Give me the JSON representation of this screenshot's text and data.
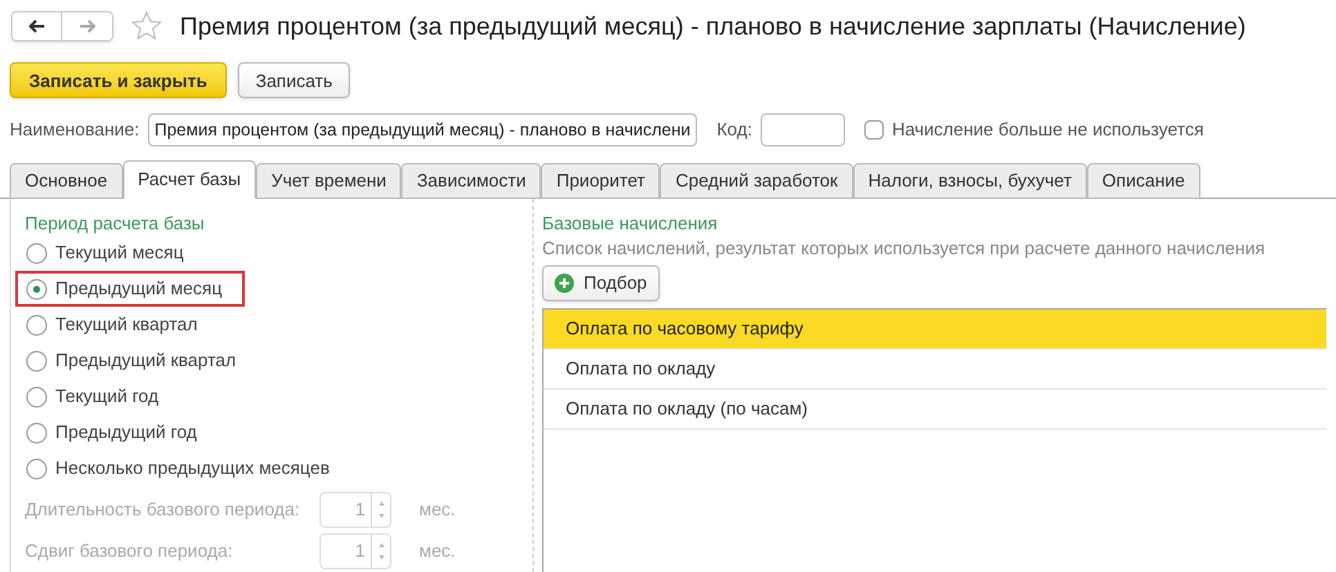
{
  "window": {
    "title": "Премия процентом (за предыдущий месяц) - планово в начисление зарплаты (Начисление)",
    "favorite": false
  },
  "buttons": [
    {
      "label": "Записать и закрыть",
      "kind": "primary"
    },
    {
      "label": "Записать",
      "kind": "default"
    }
  ],
  "name_field": {
    "label": "Наименование:",
    "value": "Премия процентом (за предыдущий месяц) - планово в начислени"
  },
  "code_field": {
    "label": "Код:"
  },
  "unused_checkbox": {
    "label": "Начисление больше не используется",
    "checked": false
  },
  "tabs": [
    {
      "label": "Основное",
      "selected": false
    },
    {
      "label": "Расчет базы",
      "selected": true
    },
    {
      "label": "Учет времени",
      "selected": false
    },
    {
      "label": "Зависимости",
      "selected": false
    },
    {
      "label": "Приоритет",
      "selected": false
    },
    {
      "label": "Средний заработок",
      "selected": false
    },
    {
      "label": "Налоги, взносы, бухучет",
      "selected": false
    },
    {
      "label": "Описание",
      "selected": false
    }
  ],
  "period": {
    "heading": "Период расчета базы",
    "options": [
      {
        "label": "Текущий месяц",
        "selected": false,
        "highlighted": false
      },
      {
        "label": "Предыдущий месяц",
        "selected": true,
        "highlighted": true
      },
      {
        "label": "Текущий квартал",
        "selected": false,
        "highlighted": false
      },
      {
        "label": "Предыдущий квартал",
        "selected": false,
        "highlighted": false
      },
      {
        "label": "Текущий год",
        "selected": false,
        "highlighted": false
      },
      {
        "label": "Предыдущий год",
        "selected": false,
        "highlighted": false
      },
      {
        "label": "Несколько предыдущих месяцев",
        "selected": false,
        "highlighted": false
      }
    ],
    "fields": [
      {
        "label": "Длительность базового периода:",
        "value": "1",
        "unit": "мес.",
        "disabled": true
      },
      {
        "label": "Сдвиг базового периода:",
        "value": "1",
        "unit": "мес.",
        "disabled": true
      }
    ]
  },
  "base": {
    "heading": "Базовые начисления",
    "description": "Список начислений, результат которых используется при расчете данного начисления",
    "pick_button": "Подбор",
    "rows": [
      {
        "label": "Оплата по часовому тарифу",
        "selected": true
      },
      {
        "label": "Оплата по окладу",
        "selected": false
      },
      {
        "label": "Оплата по окладу (по часам)",
        "selected": false
      }
    ]
  }
}
